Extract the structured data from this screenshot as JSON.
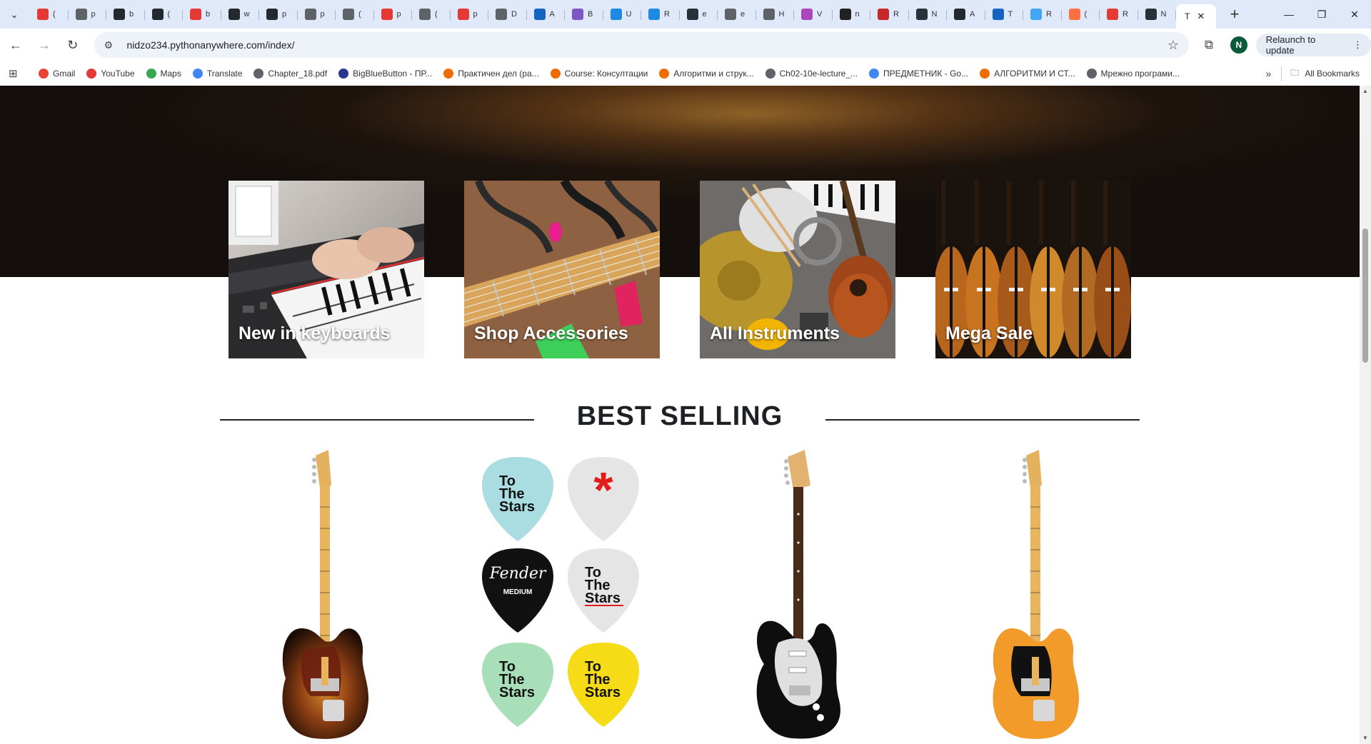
{
  "browser": {
    "tab_favicons": [
      "#e53935",
      "#5f6368",
      "#24292f",
      "#24292f",
      "#e53935",
      "#24292f",
      "#24292f",
      "#5f6368",
      "#5f6368",
      "#e53935",
      "#5f6368",
      "#e53935",
      "#5f6368",
      "#1565c0",
      "#7e57c2",
      "#1e88e5",
      "#1e88e5",
      "#263238",
      "#5f6368",
      "#5f6368",
      "#ab47bc",
      "#212121",
      "#c62828",
      "#263238",
      "#24292f",
      "#1565c0",
      "#42a5f5",
      "#ff7043",
      "#e53935",
      "#263238",
      "#5f6368"
    ],
    "tab_letters": [
      "(",
      "p",
      "b",
      "(",
      "b",
      "w",
      "p",
      "p",
      "(",
      "p",
      "(",
      "p",
      "D",
      "A",
      "B",
      "U",
      "R",
      "e",
      "e",
      "H",
      "V",
      "n",
      "R",
      "N",
      "A",
      "T",
      "R",
      "(",
      "R",
      "N"
    ],
    "active_tab_title": "T",
    "url": "nidzo234.pythonanywhere.com/index/",
    "profile_initial": "N",
    "relaunch_label": "Relaunch to update",
    "bookmarks": [
      {
        "label": "Gmail",
        "color": "#ea4335"
      },
      {
        "label": "YouTube",
        "color": "#e53935"
      },
      {
        "label": "Maps",
        "color": "#34a853"
      },
      {
        "label": "Translate",
        "color": "#4285f4"
      },
      {
        "label": "Chapter_18.pdf",
        "color": "#5f6368"
      },
      {
        "label": "BigBlueButton - ПР...",
        "color": "#283593"
      },
      {
        "label": "Практичен дел (ра...",
        "color": "#ef6c00"
      },
      {
        "label": "Course: Консултации",
        "color": "#ef6c00"
      },
      {
        "label": "Алгоритми и струк...",
        "color": "#ef6c00"
      },
      {
        "label": "Ch02-10e-lecture_...",
        "color": "#5f6368"
      },
      {
        "label": "ПРЕДМЕТНИК - Go...",
        "color": "#4285f4"
      },
      {
        "label": "АЛГОРИТМИ И СТ...",
        "color": "#ef6c00"
      },
      {
        "label": "Мрежно програми...",
        "color": "#5f6368"
      }
    ],
    "all_bookmarks_label": "All Bookmarks"
  },
  "categories": [
    {
      "label": "New in keyboards"
    },
    {
      "label": "Shop Accessories"
    },
    {
      "label": "All Instruments"
    },
    {
      "label": "Mega Sale"
    }
  ],
  "section_heading": "BEST SELLING",
  "picks": {
    "text": "To The Stars",
    "brand": "Fender",
    "size": "MEDIUM"
  }
}
